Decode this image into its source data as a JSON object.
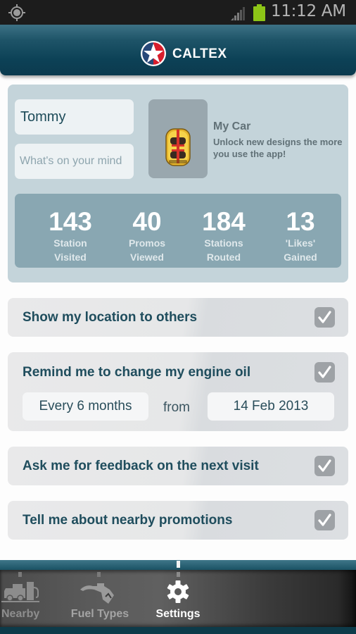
{
  "status_bar": {
    "time": "11:12 AM",
    "icons": [
      "gps-icon",
      "signal-icon",
      "battery-icon"
    ],
    "battery_color": "#8dc517"
  },
  "header": {
    "brand": "CALTEX",
    "logo_icon": "caltex-star-logo",
    "colors": {
      "header_bg": "#0c4156",
      "star_red": "#d81e2c"
    }
  },
  "profile": {
    "name_value": "Tommy",
    "status_placeholder": "What's on your mind",
    "car": {
      "icon": "car-icon",
      "title": "My Car",
      "description": "Unlock new designs the more you use the app!"
    },
    "stats": [
      {
        "value": "143",
        "label_line1": "Station",
        "label_line2": "Visited"
      },
      {
        "value": "40",
        "label_line1": "Promos",
        "label_line2": "Viewed"
      },
      {
        "value": "184",
        "label_line1": "Stations",
        "label_line2": "Routed"
      },
      {
        "value": "13",
        "label_line1": "'Likes'",
        "label_line2": "Gained"
      }
    ]
  },
  "settings": [
    {
      "label": "Show my location to others",
      "checked": true
    },
    {
      "label": "Remind me to change my engine oil",
      "checked": true,
      "interval": "Every 6 months",
      "from_label": "from",
      "start_date": "14 Feb 2013"
    },
    {
      "label": "Ask me for feedback on the next visit",
      "checked": true
    },
    {
      "label": "Tell me about nearby promotions",
      "checked": true
    }
  ],
  "bottom_nav": {
    "items": [
      {
        "label": "Nearby",
        "icon": "fuel-station-car-icon",
        "active": false
      },
      {
        "label": "Fuel Types",
        "icon": "fuel-nozzle-icon",
        "active": false
      },
      {
        "label": "Settings",
        "icon": "gear-icon",
        "active": true
      }
    ],
    "colors": {
      "active": "#ffffff",
      "inactive": "#9a9a9a"
    }
  }
}
